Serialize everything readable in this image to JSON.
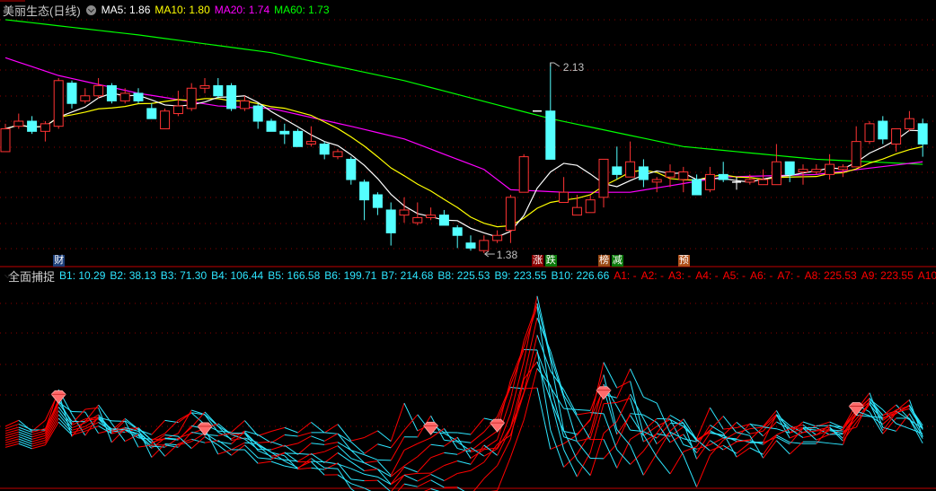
{
  "header": {
    "title": "美丽生态(日线)",
    "ma": [
      {
        "label": "MA5:",
        "value": "1.86",
        "color": "#ffffff"
      },
      {
        "label": "MA10:",
        "value": "1.80",
        "color": "#ffff00"
      },
      {
        "label": "MA20:",
        "value": "1.74",
        "color": "#ff00ff"
      },
      {
        "label": "MA60:",
        "value": "1.73",
        "color": "#00ff00"
      }
    ]
  },
  "chart_data": {
    "type": "candlestick",
    "up_color": "#ff3333",
    "down_color": "#54ffff",
    "grid": true,
    "candles": [
      [
        1.78,
        1.89,
        1.78,
        1.87
      ],
      [
        1.88,
        1.93,
        1.87,
        1.9
      ],
      [
        1.9,
        1.92,
        1.85,
        1.86
      ],
      [
        1.86,
        1.9,
        1.82,
        1.89
      ],
      [
        1.88,
        2.07,
        1.87,
        2.06
      ],
      [
        2.05,
        2.06,
        1.95,
        1.97
      ],
      [
        1.98,
        2.03,
        1.97,
        2.0
      ],
      [
        2.0,
        2.07,
        1.99,
        2.04
      ],
      [
        2.04,
        2.05,
        1.97,
        1.98
      ],
      [
        1.98,
        2.03,
        1.97,
        2.01
      ],
      [
        2.01,
        2.03,
        1.97,
        1.98
      ],
      [
        1.95,
        1.97,
        1.91,
        1.91
      ],
      [
        1.87,
        1.95,
        1.87,
        1.94
      ],
      [
        1.93,
        2.02,
        1.92,
        1.96
      ],
      [
        1.95,
        2.05,
        1.94,
        2.03
      ],
      [
        2.03,
        2.07,
        2.01,
        2.04
      ],
      [
        2.04,
        2.07,
        1.99,
        2.0
      ],
      [
        2.04,
        2.05,
        1.94,
        1.95
      ],
      [
        1.95,
        2.0,
        1.94,
        1.98
      ],
      [
        1.96,
        1.97,
        1.87,
        1.9
      ],
      [
        1.9,
        1.91,
        1.86,
        1.86
      ],
      [
        1.86,
        1.89,
        1.81,
        1.85
      ],
      [
        1.86,
        1.87,
        1.8,
        1.8
      ],
      [
        1.81,
        1.88,
        1.8,
        1.82
      ],
      [
        1.81,
        1.82,
        1.75,
        1.77
      ],
      [
        1.76,
        1.79,
        1.75,
        1.78
      ],
      [
        1.75,
        1.76,
        1.65,
        1.67
      ],
      [
        1.66,
        1.67,
        1.51,
        1.59
      ],
      [
        1.61,
        1.62,
        1.53,
        1.56
      ],
      [
        1.55,
        1.58,
        1.41,
        1.46
      ],
      [
        1.53,
        1.6,
        1.5,
        1.55
      ],
      [
        1.5,
        1.58,
        1.49,
        1.52
      ],
      [
        1.52,
        1.56,
        1.51,
        1.53
      ],
      [
        1.53,
        1.55,
        1.49,
        1.49
      ],
      [
        1.48,
        1.49,
        1.4,
        1.45
      ],
      [
        1.42,
        1.45,
        1.39,
        1.4
      ],
      [
        1.39,
        1.45,
        1.38,
        1.43
      ],
      [
        1.43,
        1.47,
        1.42,
        1.45
      ],
      [
        1.47,
        1.61,
        1.42,
        1.6
      ],
      [
        1.62,
        1.77,
        1.62,
        1.76
      ],
      [
        1.94,
        1.94,
        1.94,
        1.94
      ],
      [
        1.94,
        2.13,
        1.75,
        1.75
      ],
      [
        1.58,
        1.68,
        1.58,
        1.62
      ],
      [
        1.53,
        1.61,
        1.53,
        1.56
      ],
      [
        1.54,
        1.61,
        1.54,
        1.59
      ],
      [
        1.6,
        1.75,
        1.56,
        1.75
      ],
      [
        1.72,
        1.8,
        1.67,
        1.69
      ],
      [
        1.68,
        1.82,
        1.68,
        1.74
      ],
      [
        1.72,
        1.75,
        1.64,
        1.67
      ],
      [
        1.66,
        1.68,
        1.62,
        1.67
      ],
      [
        1.68,
        1.73,
        1.64,
        1.7
      ],
      [
        1.67,
        1.72,
        1.62,
        1.7
      ],
      [
        1.67,
        1.69,
        1.61,
        1.61
      ],
      [
        1.63,
        1.72,
        1.62,
        1.69
      ],
      [
        1.69,
        1.74,
        1.66,
        1.67
      ],
      [
        1.66,
        1.68,
        1.63,
        1.66
      ],
      [
        1.66,
        1.69,
        1.65,
        1.67
      ],
      [
        1.65,
        1.71,
        1.65,
        1.67
      ],
      [
        1.65,
        1.81,
        1.65,
        1.74
      ],
      [
        1.74,
        1.74,
        1.66,
        1.69
      ],
      [
        1.7,
        1.73,
        1.65,
        1.71
      ],
      [
        1.7,
        1.73,
        1.69,
        1.71
      ],
      [
        1.69,
        1.77,
        1.67,
        1.73
      ],
      [
        1.71,
        1.73,
        1.68,
        1.72
      ],
      [
        1.72,
        1.88,
        1.72,
        1.82
      ],
      [
        1.82,
        1.9,
        1.81,
        1.89
      ],
      [
        1.9,
        1.92,
        1.81,
        1.83
      ],
      [
        1.81,
        1.87,
        1.78,
        1.87
      ],
      [
        1.87,
        1.94,
        1.86,
        1.91
      ],
      [
        1.89,
        1.91,
        1.76,
        1.81
      ]
    ],
    "ma20": {
      "index": [
        0,
        4,
        10,
        16,
        20,
        26,
        30,
        36,
        38,
        42,
        47,
        54,
        61,
        69
      ],
      "values": [
        2.15,
        2.08,
        2.01,
        1.96,
        1.95,
        1.88,
        1.83,
        1.71,
        1.63,
        1.62,
        1.62,
        1.68,
        1.69,
        1.74
      ]
    },
    "ma60": {
      "index": [
        0,
        10,
        20,
        30,
        41,
        51,
        61,
        69
      ],
      "values": [
        2.3,
        2.24,
        2.17,
        2.06,
        1.91,
        1.8,
        1.75,
        1.73
      ]
    },
    "high_label": "2.13",
    "low_label": "1.38",
    "high_index": 41,
    "low_index": 36,
    "event_markers": [
      {
        "index": 4,
        "text": "财",
        "color": "#1c3f7a"
      },
      {
        "index": 40,
        "text": "涨",
        "color": "#8b0000"
      },
      {
        "index": 41,
        "text": "跌",
        "color": "#0a7a0a"
      },
      {
        "index": 45,
        "text": "榜",
        "color": "#9a4a14"
      },
      {
        "index": 46,
        "text": "减",
        "color": "#0a7a0a"
      },
      {
        "index": 51,
        "text": "预",
        "color": "#b0501a"
      }
    ]
  },
  "indicator": {
    "name": "全面捕捉",
    "b_color": "#2ee6ff",
    "a_color": "#ff0000",
    "b_legend": [
      {
        "label": "B1:",
        "value": "10.29"
      },
      {
        "label": "B2:",
        "value": "38.13"
      },
      {
        "label": "B3:",
        "value": "71.30"
      },
      {
        "label": "B4:",
        "value": "106.44"
      },
      {
        "label": "B5:",
        "value": "166.58"
      },
      {
        "label": "B6:",
        "value": "199.71"
      },
      {
        "label": "B7:",
        "value": "214.68"
      },
      {
        "label": "B8:",
        "value": "225.53"
      },
      {
        "label": "B9:",
        "value": "223.55"
      },
      {
        "label": "B10:",
        "value": "226.66"
      }
    ],
    "a_legend": [
      {
        "label": "A1:",
        "value": "-"
      },
      {
        "label": "A2:",
        "value": "-"
      },
      {
        "label": "A3:",
        "value": "-"
      },
      {
        "label": "A4:",
        "value": "-"
      },
      {
        "label": "A5:",
        "value": "-"
      },
      {
        "label": "A6:",
        "value": "-"
      },
      {
        "label": "A7:",
        "value": "-"
      },
      {
        "label": "A8:",
        "value": "225.53"
      },
      {
        "label": "A9:",
        "value": "223.55"
      },
      {
        "label": "A10",
        "value": ""
      }
    ],
    "signal_indices": [
      4,
      15,
      32,
      37,
      45,
      64
    ]
  }
}
